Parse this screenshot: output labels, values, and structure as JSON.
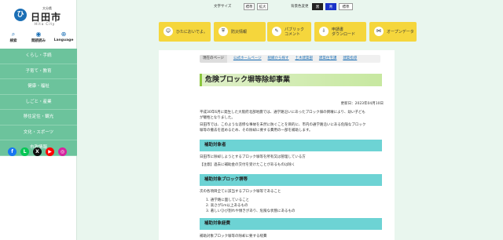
{
  "sidebar": {
    "logo": {
      "prefecture": "大分県",
      "city": "日田市",
      "english": "Hita City",
      "mark": "ひ"
    },
    "tools": [
      {
        "icon": "search-icon",
        "glyph": "⌕",
        "label": "検索"
      },
      {
        "icon": "reading-icon",
        "glyph": "◉",
        "label": "閲読読み"
      },
      {
        "icon": "language-icon",
        "glyph": "⊕",
        "label": "Language"
      }
    ],
    "menu": [
      "くらし・手続",
      "子育て・教育",
      "健康・福祉",
      "しごと・産業",
      "移住定住・観光",
      "文化・スポーツ",
      "市政情報"
    ],
    "sns": [
      {
        "name": "facebook",
        "glyph": "f",
        "color": "#1877f2"
      },
      {
        "name": "line",
        "glyph": "L",
        "color": "#06c755"
      },
      {
        "name": "x",
        "glyph": "X",
        "color": "#111111"
      },
      {
        "name": "youtube",
        "glyph": "▶",
        "color": "#ff0000"
      },
      {
        "name": "instagram",
        "glyph": "◎",
        "color": "#d6249f"
      }
    ]
  },
  "topbar": {
    "font_size_label": "文字サイズ",
    "font_standard": "標準",
    "font_large": "拡大",
    "bg_color_label": "背景色変更",
    "bg_black": "黒",
    "bg_blue": "青",
    "bg_standard": "標準"
  },
  "quick_links": [
    {
      "icon": "face-icon",
      "glyph": "☺",
      "label": "ひたにおいでよ。"
    },
    {
      "icon": "shield-icon",
      "glyph": "⛨",
      "label": "防災情報"
    },
    {
      "icon": "comment-icon",
      "glyph": "✎",
      "label": "パブリック\nコメント"
    },
    {
      "icon": "download-icon",
      "glyph": "⇩",
      "label": "申請書\nダウンロード"
    },
    {
      "icon": "network-icon",
      "glyph": "⋈",
      "label": "オープンデータ"
    }
  ],
  "breadcrumbs": [
    "現在のページ",
    "公式ホームページ",
    "組織から探す",
    "土木建築部",
    "建築住宅課",
    "建築指導"
  ],
  "page_title": "危険ブロック塀等除却事業",
  "updated": "更新日：2023年04月10日",
  "intro": [
    "平成30年6月に発生した大阪府北部地震では、通学路沿いにあったブロック塀の倒壊により、幼い子ども",
    "が犠牲となりました。",
    "日田市では、このような悲惨な事故を未然に防ぐことを目的に、市内の通学路沿いにある危険なブロック",
    "塀等の撤去を進めるため、その除却に要する費用の一部を補助します。"
  ],
  "sections": {
    "target_heading": "補助対象者",
    "target_text": [
      "日田市に除却しようとするブロック塀等を所有又は管理している方",
      "【注意】過去に補助金の交付を受けたことがあるものは除く"
    ],
    "wall_heading": "補助対象ブロック塀等",
    "wall_intro": "次の各項目全てに該当するブロック塀等であること",
    "wall_items": [
      "1. 通学路に面していること",
      "2. 高さが1m以上あるもの",
      "3. 著しいひび割れや傾きがあり、危険な状態にあるもの"
    ],
    "cost_heading": "補助対象経費",
    "cost_text": "補助対象ブロック塀等の除却に要する経費"
  }
}
